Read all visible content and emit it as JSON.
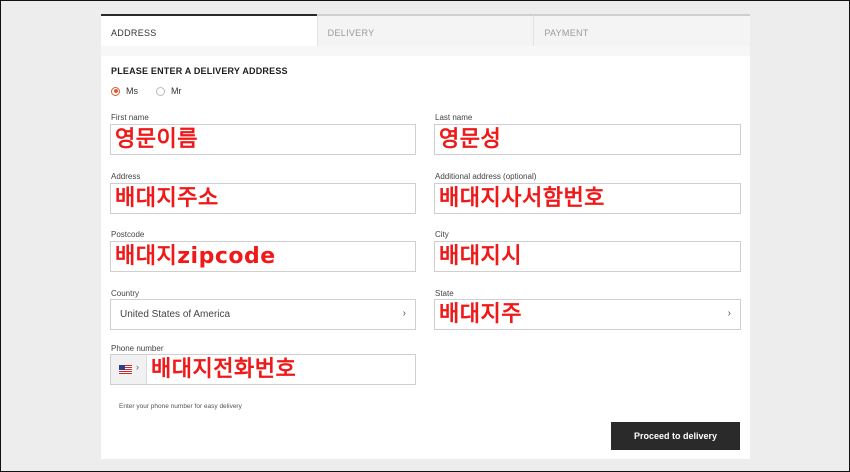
{
  "tabs": [
    {
      "label": "ADDRESS",
      "active": true
    },
    {
      "label": "DELIVERY",
      "active": false
    },
    {
      "label": "PAYMENT",
      "active": false
    }
  ],
  "form": {
    "heading": "PLEASE ENTER A DELIVERY ADDRESS",
    "salutation": {
      "options": [
        "Ms",
        "Mr"
      ],
      "selected": "Ms"
    },
    "first_name": {
      "label": "First name",
      "value": "영문이름"
    },
    "last_name": {
      "label": "Last name",
      "value": "영문성"
    },
    "address": {
      "label": "Address",
      "value": "배대지주소"
    },
    "additional_address": {
      "label": "Additional address (optional)",
      "value": "배대지사서함번호"
    },
    "postcode": {
      "label": "Postcode",
      "value": "배대지zipcode"
    },
    "city": {
      "label": "City",
      "value": "배대지시"
    },
    "country": {
      "label": "Country",
      "value": "United States of America"
    },
    "state": {
      "label": "State",
      "value": "배대지주"
    },
    "phone": {
      "label": "Phone number",
      "value": "배대지전화번호",
      "hint": "Enter your phone number for easy delivery"
    },
    "chevron": "›"
  },
  "actions": {
    "proceed_label": "Proceed to delivery"
  },
  "colors": {
    "accent": "#e15a3a",
    "annotation": "#f01919",
    "button": "#2a2a2a"
  },
  "icons": {
    "flag": "us-flag-icon",
    "chevron": "chevron-right-icon"
  }
}
